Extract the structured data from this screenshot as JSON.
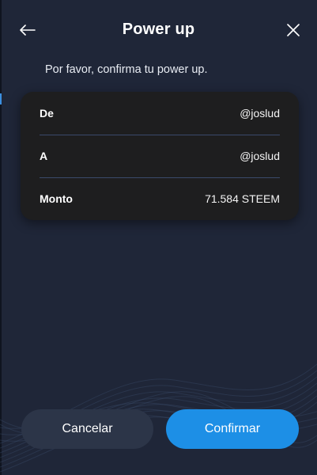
{
  "header": {
    "title": "Power up",
    "back_icon": "arrow-left-icon",
    "close_icon": "close-icon"
  },
  "message": "Por favor, confirma tu power up.",
  "details": [
    {
      "label": "De",
      "value": "@joslud"
    },
    {
      "label": "A",
      "value": "@joslud"
    },
    {
      "label": "Monto",
      "value": "71.584 STEEM"
    }
  ],
  "actions": {
    "cancel_label": "Cancelar",
    "confirm_label": "Confirmar"
  },
  "colors": {
    "background": "#1f2638",
    "card": "#1e1e1f",
    "accent": "#1d8fe6",
    "cancel_button": "#2c3548",
    "divider": "#3b4a6a"
  }
}
